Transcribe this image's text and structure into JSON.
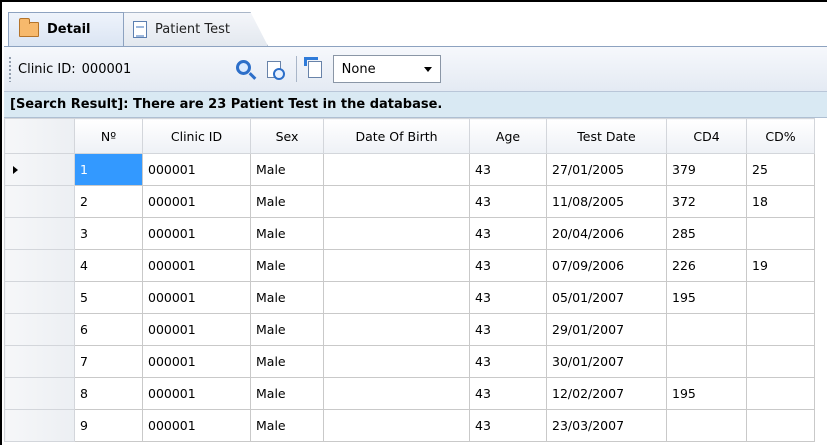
{
  "tabs": [
    {
      "label": "Detail",
      "icon": "folder-icon",
      "active": true
    },
    {
      "label": "Patient Test",
      "icon": "document-icon",
      "active": false
    }
  ],
  "toolbar": {
    "clinic_label": "Clinic ID:",
    "clinic_value": "000001",
    "filter_value": "None"
  },
  "result_message": "[Search Result]: There are 23 Patient Test in the database.",
  "columns": [
    "Nº",
    "Clinic ID",
    "Sex",
    "Date Of Birth",
    "Age",
    "Test Date",
    "CD4",
    "CD%"
  ],
  "rows": [
    {
      "no": "1",
      "clinic_id": "000001",
      "sex": "Male",
      "dob": "",
      "age": "43",
      "test_date": "27/01/2005",
      "cd4": "379",
      "cd_pct": "25"
    },
    {
      "no": "2",
      "clinic_id": "000001",
      "sex": "Male",
      "dob": "",
      "age": "43",
      "test_date": "11/08/2005",
      "cd4": "372",
      "cd_pct": "18"
    },
    {
      "no": "3",
      "clinic_id": "000001",
      "sex": "Male",
      "dob": "",
      "age": "43",
      "test_date": "20/04/2006",
      "cd4": "285",
      "cd_pct": ""
    },
    {
      "no": "4",
      "clinic_id": "000001",
      "sex": "Male",
      "dob": "",
      "age": "43",
      "test_date": "07/09/2006",
      "cd4": "226",
      "cd_pct": "19"
    },
    {
      "no": "5",
      "clinic_id": "000001",
      "sex": "Male",
      "dob": "",
      "age": "43",
      "test_date": "05/01/2007",
      "cd4": "195",
      "cd_pct": ""
    },
    {
      "no": "6",
      "clinic_id": "000001",
      "sex": "Male",
      "dob": "",
      "age": "43",
      "test_date": "29/01/2007",
      "cd4": "",
      "cd_pct": ""
    },
    {
      "no": "7",
      "clinic_id": "000001",
      "sex": "Male",
      "dob": "",
      "age": "43",
      "test_date": "30/01/2007",
      "cd4": "",
      "cd_pct": ""
    },
    {
      "no": "8",
      "clinic_id": "000001",
      "sex": "Male",
      "dob": "",
      "age": "43",
      "test_date": "12/02/2007",
      "cd4": "195",
      "cd_pct": ""
    },
    {
      "no": "9",
      "clinic_id": "000001",
      "sex": "Male",
      "dob": "",
      "age": "43",
      "test_date": "23/03/2007",
      "cd4": "",
      "cd_pct": ""
    }
  ],
  "selected_row": 0,
  "colors": {
    "selection": "#3399ff",
    "result_bar": "#d9e9f3",
    "search_icon": "#2d6fc9"
  }
}
